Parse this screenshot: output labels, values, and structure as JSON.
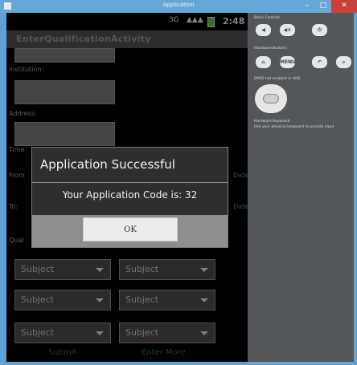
{
  "window": {
    "title": "Application",
    "minimize_glyph": "–",
    "maximize_glyph": "□",
    "close_glyph": "✕"
  },
  "status_bar": {
    "signal_1": "3G",
    "signal_2": "▲▲▲",
    "time": "2:48"
  },
  "app": {
    "title": "EnterQualificationActivity",
    "labels": {
      "institution": "Institution:",
      "address": "Address:",
      "time": "Time",
      "from": "From",
      "to": "To:",
      "qual": "Qual",
      "date_1": "Date",
      "date_2": "Date"
    },
    "subjects": [
      {
        "left": "Subject",
        "right": "Subject"
      },
      {
        "left": "Subject",
        "right": "Subject"
      },
      {
        "left": "Subject",
        "right": "Subject"
      }
    ],
    "submit_label": "Submit",
    "enter_more_label": "Enter More"
  },
  "dialog": {
    "title": "Application Successful",
    "message": "Your Application Code is: 32",
    "ok_label": "OK"
  },
  "controls": {
    "basic_controls_title": "Basic Controls",
    "hardware_buttons_title": "Hardware Buttons",
    "menu_label": "MENU",
    "dpad_title": "DPAD not enabled in AVD",
    "keyboard_title": "Hardware Keyboard",
    "keyboard_desc": "Use your physical keyboard to provide input"
  },
  "colors": {
    "dialog_footer": "#8e8e8e",
    "button_text_green": "#2e6f4e",
    "window_frame": "#60a2d5"
  }
}
